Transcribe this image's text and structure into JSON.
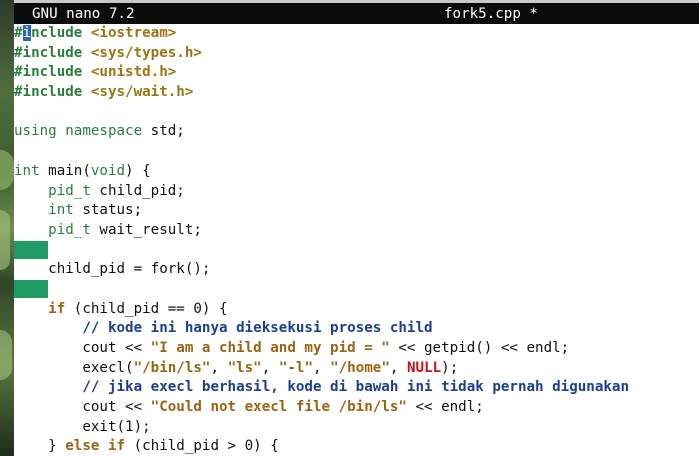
{
  "titlebar": {
    "app": "GNU nano 7.2",
    "file": "fork5.cpp *"
  },
  "editor": {
    "lines": [
      {
        "parts": [
          {
            "t": "#",
            "c": "pp"
          },
          {
            "t": "i",
            "c": "cursor"
          },
          {
            "t": "nclude",
            "c": "pp"
          },
          {
            "t": " ",
            "c": ""
          },
          {
            "t": "<iostream>",
            "c": "inc"
          }
        ]
      },
      {
        "parts": [
          {
            "t": "#include",
            "c": "pp"
          },
          {
            "t": " ",
            "c": ""
          },
          {
            "t": "<sys/types.h>",
            "c": "inc"
          }
        ]
      },
      {
        "parts": [
          {
            "t": "#include",
            "c": "pp"
          },
          {
            "t": " ",
            "c": ""
          },
          {
            "t": "<unistd.h>",
            "c": "inc"
          }
        ]
      },
      {
        "parts": [
          {
            "t": "#include",
            "c": "pp"
          },
          {
            "t": " ",
            "c": ""
          },
          {
            "t": "<sys/wait.h>",
            "c": "inc"
          }
        ]
      },
      {
        "parts": []
      },
      {
        "parts": [
          {
            "t": "using namespace",
            "c": "kw"
          },
          {
            "t": " std;",
            "c": ""
          }
        ]
      },
      {
        "parts": []
      },
      {
        "parts": [
          {
            "t": "int",
            "c": "kw"
          },
          {
            "t": " main(",
            "c": ""
          },
          {
            "t": "void",
            "c": "kw"
          },
          {
            "t": ") {",
            "c": ""
          }
        ]
      },
      {
        "parts": [
          {
            "t": "    ",
            "c": ""
          },
          {
            "t": "pid_t",
            "c": "kw"
          },
          {
            "t": " child_pid;",
            "c": ""
          }
        ]
      },
      {
        "parts": [
          {
            "t": "    ",
            "c": ""
          },
          {
            "t": "int",
            "c": "kw"
          },
          {
            "t": " status;",
            "c": ""
          }
        ]
      },
      {
        "parts": [
          {
            "t": "    ",
            "c": ""
          },
          {
            "t": "pid_t",
            "c": "kw"
          },
          {
            "t": " wait_result;",
            "c": ""
          }
        ]
      },
      {
        "parts": [
          {
            "t": "",
            "c": "ws"
          }
        ]
      },
      {
        "parts": [
          {
            "t": "    child_pid = fork();",
            "c": ""
          }
        ]
      },
      {
        "parts": [
          {
            "t": "",
            "c": "ws"
          }
        ]
      },
      {
        "parts": [
          {
            "t": "    ",
            "c": ""
          },
          {
            "t": "if",
            "c": "kwb"
          },
          {
            "t": " (child_pid == 0) {",
            "c": ""
          }
        ]
      },
      {
        "parts": [
          {
            "t": "        ",
            "c": ""
          },
          {
            "t": "// kode ini hanya dieksekusi proses child",
            "c": "cmt"
          }
        ]
      },
      {
        "parts": [
          {
            "t": "        cout << ",
            "c": ""
          },
          {
            "t": "\"I am a child and my pid = \"",
            "c": "str"
          },
          {
            "t": " << getpid() << endl;",
            "c": ""
          }
        ]
      },
      {
        "parts": [
          {
            "t": "        execl(",
            "c": ""
          },
          {
            "t": "\"/bin/ls\"",
            "c": "str"
          },
          {
            "t": ", ",
            "c": ""
          },
          {
            "t": "\"ls\"",
            "c": "str"
          },
          {
            "t": ", ",
            "c": ""
          },
          {
            "t": "\"-l\"",
            "c": "str"
          },
          {
            "t": ", ",
            "c": ""
          },
          {
            "t": "\"/home\"",
            "c": "str"
          },
          {
            "t": ", ",
            "c": ""
          },
          {
            "t": "NULL",
            "c": "nul"
          },
          {
            "t": ");",
            "c": ""
          }
        ]
      },
      {
        "parts": [
          {
            "t": "        ",
            "c": ""
          },
          {
            "t": "// jika execl berhasil, kode di bawah ini tidak pernah digunakan",
            "c": "cmt"
          }
        ]
      },
      {
        "parts": [
          {
            "t": "        cout << ",
            "c": ""
          },
          {
            "t": "\"Could not execl file /bin/ls\"",
            "c": "str"
          },
          {
            "t": " << endl;",
            "c": ""
          }
        ]
      },
      {
        "parts": [
          {
            "t": "        exit(1);",
            "c": ""
          }
        ]
      },
      {
        "parts": [
          {
            "t": "    } ",
            "c": ""
          },
          {
            "t": "else if",
            "c": "kwb"
          },
          {
            "t": " (child_pid > 0) {",
            "c": ""
          }
        ]
      }
    ]
  }
}
